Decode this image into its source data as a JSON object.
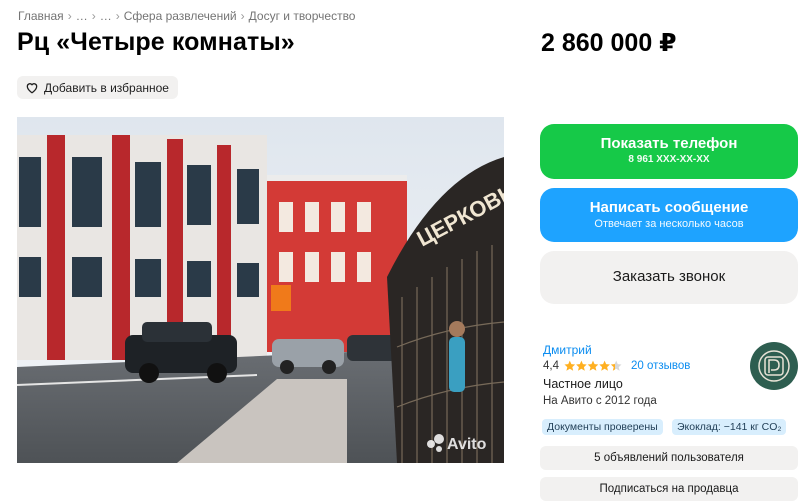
{
  "breadcrumbs": [
    "Главная",
    "…",
    "…",
    "Сфера развлечений",
    "Досуг и творчество"
  ],
  "listing": {
    "title": "Рц «Четыре комнаты»",
    "price": "2 860 000 ₽",
    "favorite_label": "Добавить в избранное",
    "photo_watermark": "Avito",
    "photo_sign_text": "ЦЕРКОВНА"
  },
  "contact": {
    "phone_label": "Показать телефон",
    "phone_masked": "8 961 XXX-XX-XX",
    "message_label": "Написать сообщение",
    "message_sub": "Отвечает за несколько часов",
    "call_label": "Заказать звонок"
  },
  "seller": {
    "name": "Дмитрий",
    "rating": "4,4",
    "stars_filled": 4.4,
    "reviews": "20 отзывов",
    "type": "Частное лицо",
    "since": "На Авито с 2012 года",
    "badges": [
      "Документы проверены",
      "Экоклад: −141 кг CO₂"
    ],
    "ads_label": "5 объявлений пользователя",
    "subscribe_label": "Подписаться на продавца"
  },
  "colors": {
    "green": "#16c948",
    "blue": "#1ea3ff",
    "link": "#0a8cf0",
    "star": "#ffb021"
  },
  "icons": {
    "favorite": "heart-outline-icon",
    "rating": "star-icon"
  }
}
